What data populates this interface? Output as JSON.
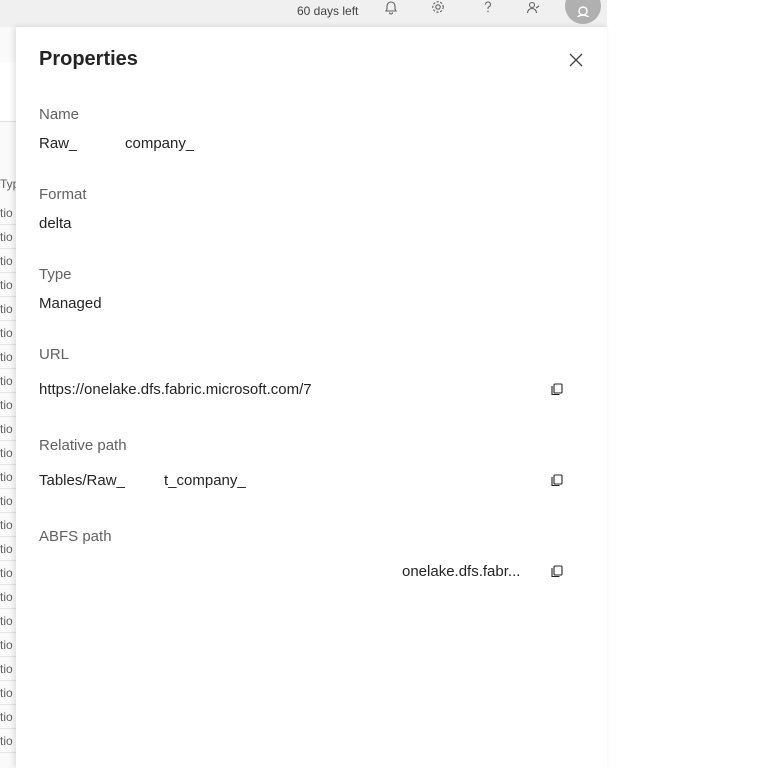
{
  "topbar": {
    "trial_text": "60 days left",
    "icons": [
      "bell-icon",
      "gear-icon",
      "help-icon",
      "share-icon",
      "user-avatar-icon"
    ]
  },
  "background": {
    "column_header": "Typ",
    "row_text": "tio"
  },
  "panel": {
    "title": "Properties",
    "close_icon": "close-icon",
    "fields": {
      "name": {
        "label": "Name",
        "value_prefix": "Raw_",
        "value_suffix": "company_"
      },
      "format": {
        "label": "Format",
        "value": "delta"
      },
      "type": {
        "label": "Type",
        "value": "Managed"
      },
      "url": {
        "label": "URL",
        "value": "https://onelake.dfs.fabric.microsoft.com/7"
      },
      "relative_path": {
        "label": "Relative path",
        "value_prefix": "Tables/Raw_",
        "value_suffix": "t_company_"
      },
      "abfs_path": {
        "label": "ABFS path",
        "value": "onelake.dfs.fabr..."
      }
    },
    "copy_icon": "copy-icon"
  }
}
